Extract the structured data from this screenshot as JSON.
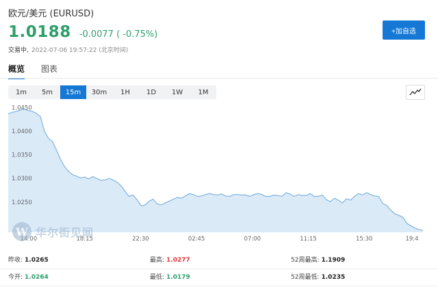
{
  "header": {
    "title": "欧元/美元 (EURUSD)",
    "price": "1.0188",
    "change": "-0.0077 ( -0.75%)",
    "status": "交易中,",
    "timestamp": "2022-07-06 19:57:22 (北京时间)",
    "add_button": "+加自选"
  },
  "tabs": [
    {
      "label": "概览",
      "active": true
    },
    {
      "label": "图表",
      "active": false
    }
  ],
  "periods": [
    {
      "label": "1m",
      "active": false
    },
    {
      "label": "5m",
      "active": false
    },
    {
      "label": "15m",
      "active": true
    },
    {
      "label": "30m",
      "active": false
    },
    {
      "label": "1H",
      "active": false
    },
    {
      "label": "1D",
      "active": false
    },
    {
      "label": "1W",
      "active": false
    },
    {
      "label": "1M",
      "active": false
    }
  ],
  "watermark": {
    "logo_letter": "W",
    "text": "华尔街见闻"
  },
  "colors": {
    "up": "#2e9e6b",
    "down": "#e0383b",
    "accent": "#1478d4",
    "line": "#7fb3de",
    "fill": "#dbeaf7"
  },
  "chart_data": {
    "type": "area",
    "x_ticks": [
      "14:00",
      "18:15",
      "22:30",
      "02:45",
      "07:00",
      "11:15",
      "15:30",
      "19:4"
    ],
    "y_ticks": [
      "1.0450",
      "1.0400",
      "1.0350",
      "1.0300",
      "1.0250"
    ],
    "ylim": [
      1.0186,
      1.0458
    ],
    "grid": false,
    "values": [
      1.0437,
      1.044,
      1.0442,
      1.0445,
      1.0447,
      1.0444,
      1.0442,
      1.0438,
      1.0431,
      1.04,
      1.0385,
      1.0378,
      1.036,
      1.034,
      1.0325,
      1.0315,
      1.0308,
      1.0305,
      1.0301,
      1.0303,
      1.0299,
      1.0304,
      1.03,
      1.0296,
      1.0297,
      1.03,
      1.0297,
      1.0292,
      1.0285,
      1.0273,
      1.0262,
      1.0265,
      1.0255,
      1.0242,
      1.0244,
      1.0252,
      1.0256,
      1.0246,
      1.0244,
      1.0248,
      1.0252,
      1.0256,
      1.026,
      1.0258,
      1.0263,
      1.0268,
      1.0266,
      1.0262,
      1.0263,
      1.0266,
      1.0268,
      1.0266,
      1.0265,
      1.0267,
      1.0263,
      1.0262,
      1.0266,
      1.0266,
      1.0265,
      1.0265,
      1.0262,
      1.0266,
      1.0268,
      1.0266,
      1.0262,
      1.0262,
      1.0265,
      1.0264,
      1.0262,
      1.027,
      1.0267,
      1.0262,
      1.0266,
      1.0264,
      1.0264,
      1.0268,
      1.0262,
      1.0262,
      1.0265,
      1.0255,
      1.0251,
      1.0258,
      1.0254,
      1.0248,
      1.0257,
      1.0254,
      1.0262,
      1.0268,
      1.0265,
      1.027,
      1.0266,
      1.0263,
      1.0262,
      1.0247,
      1.0243,
      1.0233,
      1.0225,
      1.0222,
      1.0218,
      1.0205,
      1.02,
      1.0195,
      1.0192,
      1.019
    ]
  },
  "stats": [
    [
      {
        "label": "昨收:",
        "value": "1.0265",
        "tone": "neutral"
      },
      {
        "label": "最高:",
        "value": "1.0277",
        "tone": "up"
      },
      {
        "label": "52周最高:",
        "value": "1.1909",
        "tone": "neutral"
      }
    ],
    [
      {
        "label": "今开:",
        "value": "1.0264",
        "tone": "green"
      },
      {
        "label": "最低:",
        "value": "1.0179",
        "tone": "green"
      },
      {
        "label": "52周最低:",
        "value": "1.0235",
        "tone": "neutral"
      }
    ]
  ]
}
